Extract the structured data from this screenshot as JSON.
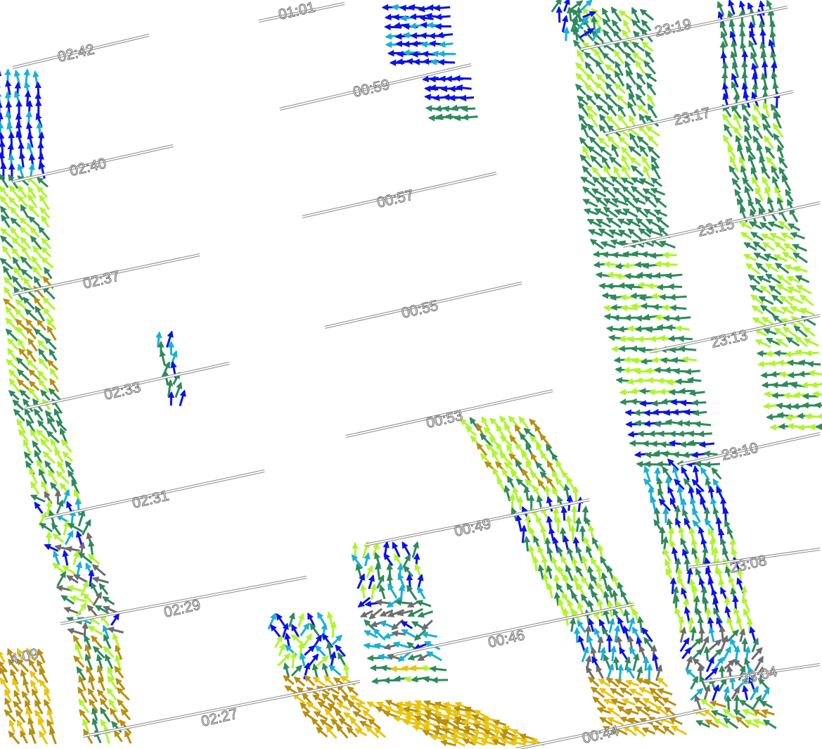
{
  "time_labels": [
    "01:01",
    "02:42",
    "00:59",
    "23:19",
    "23:17",
    "02:40",
    "00:57",
    "23:15",
    "02:37",
    "00:55",
    "23:13",
    "02:33",
    "00:53",
    "23:10",
    "02:31",
    "00:49",
    "23:08",
    "02:29",
    "00:46",
    "23:04",
    "02:27",
    "00:44",
    "4:09"
  ],
  "colors": {
    "darkblue": "#0a12e8",
    "cyan": "#1ab0d6",
    "teal": "#2e8a5c",
    "lime": "#aef52e",
    "olive": "#b8900f",
    "gold": "#e8c40f",
    "gray": "#6d6d6d"
  },
  "icons": [
    "wind-vector-arrow",
    "track-line"
  ]
}
